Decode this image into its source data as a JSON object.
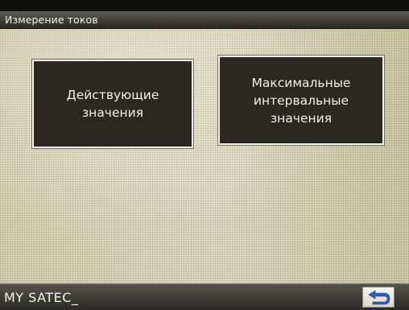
{
  "window": {
    "title": "Измерение токов"
  },
  "menu": {
    "buttons": [
      {
        "label": "Действующие\nзначения"
      },
      {
        "label": "Максимальные\nинтервальные\nзначения"
      }
    ]
  },
  "status_bar": {
    "device_name": "MY SATEC_",
    "back_icon": "back-arrow-icon"
  },
  "colors": {
    "background": "#dcd9bf",
    "button_fill": "#2b2824",
    "button_border": "#f6f4ee",
    "bar": "#3d3c36",
    "back_arrow": "#2f5fb5"
  }
}
